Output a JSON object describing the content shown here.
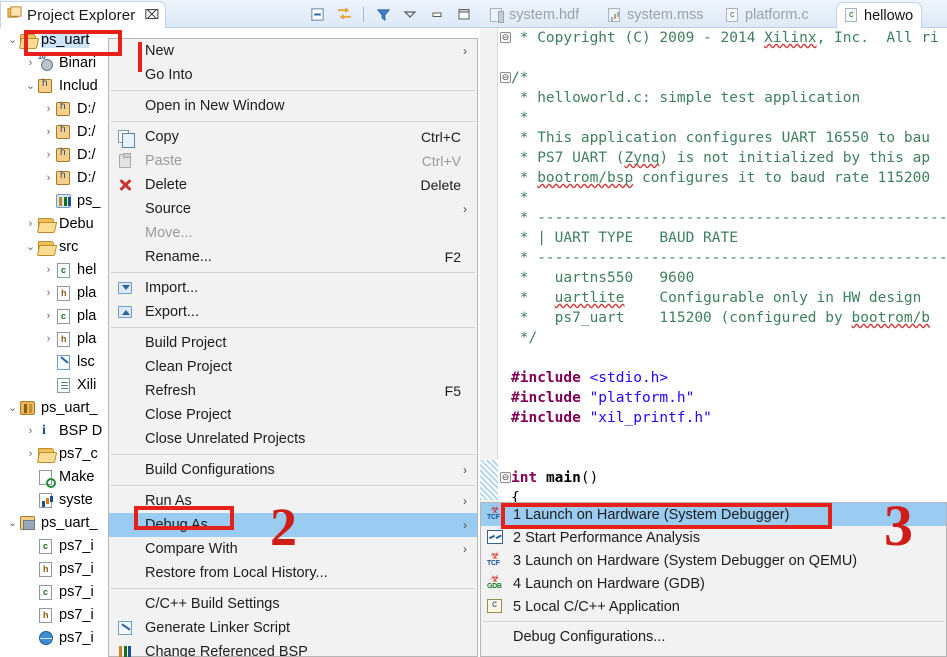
{
  "explorer": {
    "tab_title": "Project Explorer",
    "close_label": "⌧",
    "toolbar": [
      {
        "name": "collapse-all-icon",
        "glyph": "⊟"
      },
      {
        "name": "link-with-editor-icon",
        "glyph": "⇄"
      },
      {
        "name": "filter-icon",
        "glyph": "▼"
      },
      {
        "name": "view-menu-icon",
        "glyph": "▽"
      },
      {
        "name": "minimize-icon",
        "glyph": "—"
      },
      {
        "name": "maximize-icon",
        "glyph": "❐"
      }
    ],
    "tree": [
      {
        "depth": 0,
        "twisty": "⌄",
        "icon": "folder-open",
        "label": "ps_uart",
        "selected": true
      },
      {
        "depth": 1,
        "twisty": "›",
        "icon": "binaries",
        "label": "Binari"
      },
      {
        "depth": 1,
        "twisty": "⌄",
        "icon": "includes",
        "label": "Includ"
      },
      {
        "depth": 2,
        "twisty": "›",
        "icon": "include-folder",
        "label": "D:/"
      },
      {
        "depth": 2,
        "twisty": "›",
        "icon": "include-folder",
        "label": "D:/"
      },
      {
        "depth": 2,
        "twisty": "›",
        "icon": "include-folder",
        "label": "D:/"
      },
      {
        "depth": 2,
        "twisty": "›",
        "icon": "include-folder",
        "label": "D:/"
      },
      {
        "depth": 2,
        "twisty": "",
        "icon": "lib",
        "label": "ps_"
      },
      {
        "depth": 1,
        "twisty": "›",
        "icon": "folder",
        "label": "Debu"
      },
      {
        "depth": 1,
        "twisty": "⌄",
        "icon": "folder",
        "label": "src"
      },
      {
        "depth": 2,
        "twisty": "›",
        "icon": "c-file",
        "label": "hel"
      },
      {
        "depth": 2,
        "twisty": "›",
        "icon": "h-file",
        "label": "pla"
      },
      {
        "depth": 2,
        "twisty": "›",
        "icon": "c-file",
        "label": "pla"
      },
      {
        "depth": 2,
        "twisty": "›",
        "icon": "h-file",
        "label": "pla"
      },
      {
        "depth": 2,
        "twisty": "",
        "icon": "linker-script",
        "label": "lsc"
      },
      {
        "depth": 2,
        "twisty": "",
        "icon": "xml-file",
        "label": "Xili"
      },
      {
        "depth": 0,
        "twisty": "⌄",
        "icon": "bsp-project",
        "label": "ps_uart_"
      },
      {
        "depth": 1,
        "twisty": "›",
        "icon": "info",
        "label": "BSP D"
      },
      {
        "depth": 1,
        "twisty": "›",
        "icon": "folder",
        "label": "ps7_c"
      },
      {
        "depth": 1,
        "twisty": "",
        "icon": "makefile",
        "label": "Make"
      },
      {
        "depth": 1,
        "twisty": "",
        "icon": "mss-file",
        "label": "syste"
      },
      {
        "depth": 0,
        "twisty": "⌄",
        "icon": "hw-project",
        "label": "ps_uart_"
      },
      {
        "depth": 1,
        "twisty": "",
        "icon": "c-file",
        "label": "ps7_i"
      },
      {
        "depth": 1,
        "twisty": "",
        "icon": "h-file",
        "label": "ps7_i"
      },
      {
        "depth": 1,
        "twisty": "",
        "icon": "c-file",
        "label": "ps7_i"
      },
      {
        "depth": 1,
        "twisty": "",
        "icon": "h-file",
        "label": "ps7_i"
      },
      {
        "depth": 1,
        "twisty": "",
        "icon": "globe",
        "label": "ps7_i"
      }
    ]
  },
  "context_menu": {
    "items": [
      {
        "label": "New",
        "accel": "",
        "arrow": true,
        "icon": "",
        "disabled": false,
        "highlight": false
      },
      {
        "label": "Go Into",
        "accel": "",
        "arrow": false,
        "icon": "",
        "disabled": false,
        "highlight": false
      },
      {
        "separator": true
      },
      {
        "label": "Open in New Window",
        "accel": "",
        "arrow": false,
        "icon": "",
        "disabled": false,
        "highlight": false
      },
      {
        "separator": true
      },
      {
        "label": "Copy",
        "accel": "Ctrl+C",
        "arrow": false,
        "icon": "copy-icon",
        "disabled": false,
        "highlight": false
      },
      {
        "label": "Paste",
        "accel": "Ctrl+V",
        "arrow": false,
        "icon": "paste-icon",
        "disabled": true,
        "highlight": false
      },
      {
        "label": "Delete",
        "accel": "Delete",
        "arrow": false,
        "icon": "delete-icon",
        "disabled": false,
        "highlight": false
      },
      {
        "label": "Source",
        "accel": "",
        "arrow": true,
        "icon": "",
        "disabled": false,
        "highlight": false
      },
      {
        "label": "Move...",
        "accel": "",
        "arrow": false,
        "icon": "",
        "disabled": true,
        "highlight": false
      },
      {
        "label": "Rename...",
        "accel": "F2",
        "arrow": false,
        "icon": "",
        "disabled": false,
        "highlight": false
      },
      {
        "separator": true
      },
      {
        "label": "Import...",
        "accel": "",
        "arrow": false,
        "icon": "import-icon",
        "disabled": false,
        "highlight": false
      },
      {
        "label": "Export...",
        "accel": "",
        "arrow": false,
        "icon": "export-icon",
        "disabled": false,
        "highlight": false
      },
      {
        "separator": true
      },
      {
        "label": "Build Project",
        "accel": "",
        "arrow": false,
        "icon": "",
        "disabled": false,
        "highlight": false
      },
      {
        "label": "Clean Project",
        "accel": "",
        "arrow": false,
        "icon": "",
        "disabled": false,
        "highlight": false
      },
      {
        "label": "Refresh",
        "accel": "F5",
        "arrow": false,
        "icon": "",
        "disabled": false,
        "highlight": false
      },
      {
        "label": "Close Project",
        "accel": "",
        "arrow": false,
        "icon": "",
        "disabled": false,
        "highlight": false
      },
      {
        "label": "Close Unrelated Projects",
        "accel": "",
        "arrow": false,
        "icon": "",
        "disabled": false,
        "highlight": false
      },
      {
        "separator": true
      },
      {
        "label": "Build Configurations",
        "accel": "",
        "arrow": true,
        "icon": "",
        "disabled": false,
        "highlight": false
      },
      {
        "separator": true
      },
      {
        "label": "Run As",
        "accel": "",
        "arrow": true,
        "icon": "",
        "disabled": false,
        "highlight": false
      },
      {
        "label": "Debug As",
        "accel": "",
        "arrow": true,
        "icon": "",
        "disabled": false,
        "highlight": true
      },
      {
        "label": "Compare With",
        "accel": "",
        "arrow": true,
        "icon": "",
        "disabled": false,
        "highlight": false
      },
      {
        "label": "Restore from Local History...",
        "accel": "",
        "arrow": false,
        "icon": "",
        "disabled": false,
        "highlight": false
      },
      {
        "separator": true
      },
      {
        "label": "C/C++ Build Settings",
        "accel": "",
        "arrow": false,
        "icon": "",
        "disabled": false,
        "highlight": false
      },
      {
        "label": "Generate Linker Script",
        "accel": "",
        "arrow": false,
        "icon": "linker-script-icon",
        "disabled": false,
        "highlight": false
      },
      {
        "label": "Change Referenced BSP",
        "accel": "",
        "arrow": false,
        "icon": "bsp-icon",
        "disabled": false,
        "highlight": false
      }
    ]
  },
  "submenu": {
    "items": [
      {
        "label": "1 Launch on Hardware (System Debugger)",
        "icon": "tcf-debug-icon",
        "highlight": true
      },
      {
        "label": "2 Start Performance Analysis",
        "icon": "performance-icon",
        "highlight": false
      },
      {
        "label": "3 Launch on Hardware (System Debugger on QEMU)",
        "icon": "tcf-debug-icon",
        "highlight": false
      },
      {
        "label": "4 Launch on Hardware (GDB)",
        "icon": "gdb-debug-icon",
        "highlight": false
      },
      {
        "label": "5 Local C/C++ Application",
        "icon": "c-app-icon",
        "highlight": false
      },
      {
        "separator": true
      },
      {
        "label": "Debug Configurations...",
        "icon": "",
        "highlight": false
      }
    ]
  },
  "editor": {
    "tabs": [
      {
        "label": "system.hdf",
        "icon": "hdf-icon",
        "active": false
      },
      {
        "label": "system.mss",
        "icon": "mss-icon",
        "active": false
      },
      {
        "label": "platform.c",
        "icon": "c-file-icon",
        "active": false
      },
      {
        "label": "hellowo",
        "icon": "c-file-icon",
        "active": true
      }
    ],
    "code_lines": [
      " * Copyright (C) 2009 - 2014 Xilinx, Inc.  All ri",
      "",
      "/*",
      " * helloworld.c: simple test application",
      " *",
      " * This application configures UART 16550 to bau",
      " * PS7 UART (Zynq) is not initialized by this ap",
      " * bootrom/bsp configures it to baud rate 115200",
      " *",
      " * ------------------------------------------------",
      " * | UART TYPE   BAUD RATE",
      " * ------------------------------------------------",
      " *   uartns550   9600",
      " *   uartlite    Configurable only in HW design",
      " *   ps7_uart    115200 (configured by bootrom/b",
      " */",
      "",
      "#include <stdio.h>",
      "#include \"platform.h\"",
      "#include \"xil_printf.h\"",
      "",
      "",
      "int main()",
      "{"
    ]
  },
  "annotations": {
    "mark_2": "2",
    "mark_3": "3",
    "highlight_color": "#9acbf0",
    "annotation_color": "#e8201a"
  }
}
